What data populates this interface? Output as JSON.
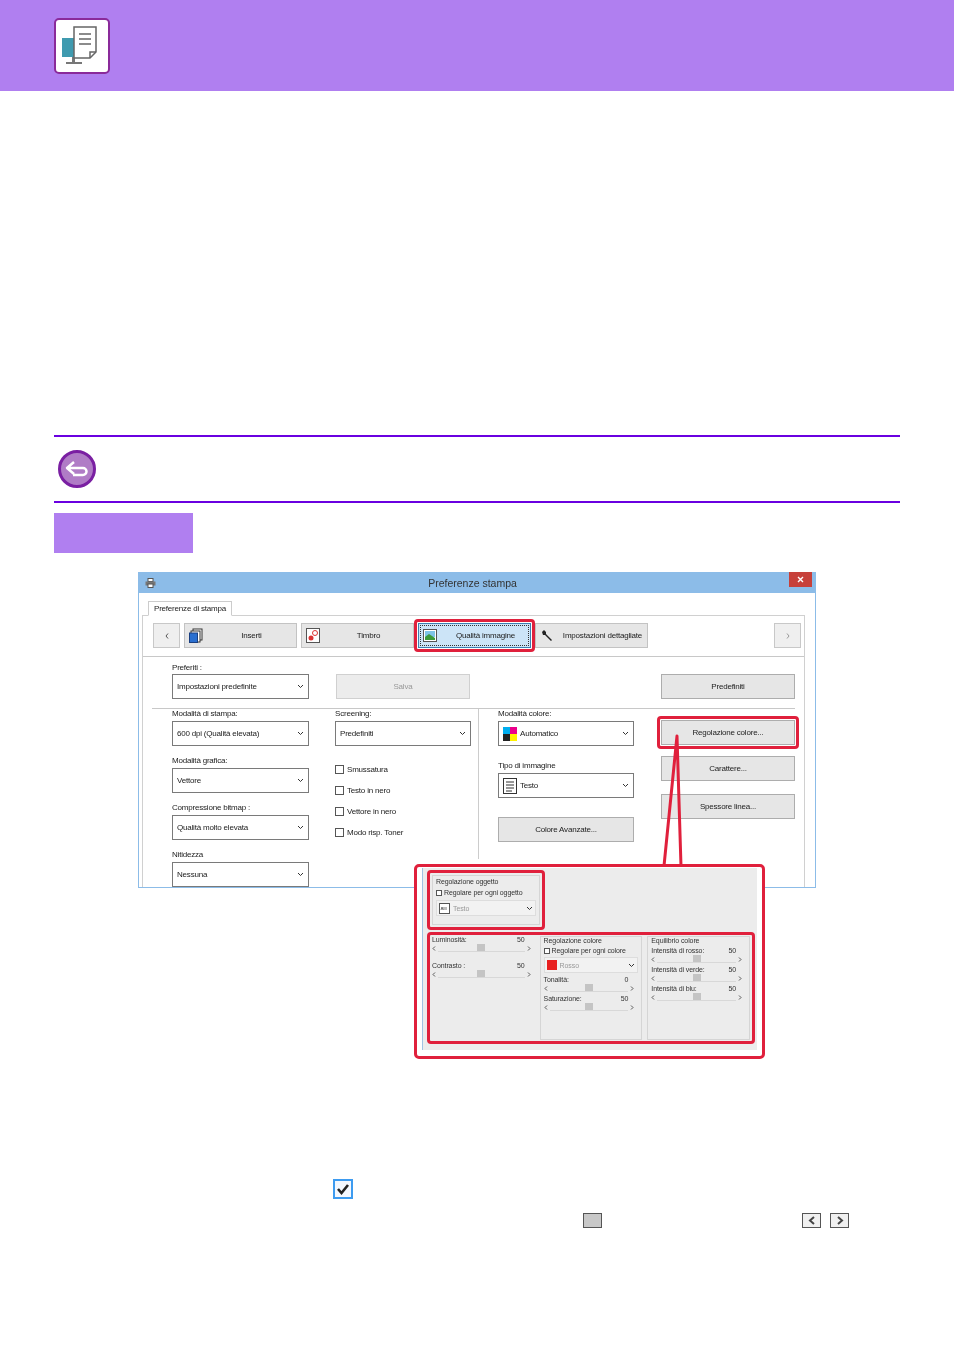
{
  "dialog": {
    "title": "Preferenze stampa",
    "page_tabs": [
      {
        "label": "Preferenze di stampa",
        "selected": true
      }
    ],
    "tabs": [
      {
        "label": "Inserti",
        "selected": false,
        "highlighted": false,
        "kind": "pages"
      },
      {
        "label": "Timbro",
        "selected": false,
        "highlighted": false,
        "kind": "stamp"
      },
      {
        "label": "Qualità immagine",
        "selected": true,
        "highlighted": true,
        "kind": "image"
      },
      {
        "label": "Impostazioni dettagliate",
        "selected": false,
        "highlighted": false,
        "kind": "wrench"
      }
    ],
    "favorites": {
      "label": "Preferiti :",
      "value": "Impostazioni predefinite"
    },
    "save_button": {
      "label": "Salva",
      "disabled": true
    },
    "defaults_button": {
      "label": "Predefiniti",
      "disabled": false
    },
    "left_fields": [
      {
        "label": "Modalità di stampa:",
        "value": "600 dpi (Qualità elevata)"
      },
      {
        "label": "Modalità grafica:",
        "value": "Vettore"
      },
      {
        "label": "Compressione bitmap :",
        "value": "Qualità molto elevata"
      },
      {
        "label": "Nitidezza",
        "value": "Nessuna"
      }
    ],
    "screening": {
      "label": "Screening:",
      "value": "Predefiniti"
    },
    "options": [
      {
        "label": "Smussatura",
        "checked": false
      },
      {
        "label": "Testo in nero",
        "checked": false
      },
      {
        "label": "Vettore in nero",
        "checked": false
      },
      {
        "label": "Modo risp. Toner",
        "checked": false
      }
    ],
    "color_mode": {
      "label": "Modalità colore:",
      "value": "Automatico"
    },
    "image_type": {
      "label": "Tipo di immagine",
      "value": "Testo"
    },
    "advanced_button": {
      "label": "Colore Avanzate..."
    },
    "side_buttons": [
      {
        "label": "Regolazione colore...",
        "highlighted": true
      },
      {
        "label": "Carattere...",
        "highlighted": false
      },
      {
        "label": "Spessore linea...",
        "highlighted": false
      }
    ]
  },
  "inset": {
    "object_adjustment": {
      "title": "Regolazione oggetto",
      "highlighted": true,
      "checkbox": {
        "label": "Regolare per ogni oggetto",
        "checked": false
      },
      "dropdown": {
        "value": "Testo",
        "disabled": true
      }
    },
    "adjustments_highlighted": true,
    "sliders": [
      {
        "label": "Luminosità:",
        "reading": "50",
        "level": 0.5
      },
      {
        "label": "Contrasto :",
        "reading": "50",
        "level": 0.5
      }
    ],
    "color_adjustment": {
      "title": "Regolazione colore",
      "checkbox": {
        "label": "Regolare per ogni colore",
        "checked": false
      },
      "dropdown": {
        "value": "Rosso",
        "disabled": true
      },
      "sliders": [
        {
          "label": "Tonalità:",
          "reading": "0",
          "level": 0.5
        },
        {
          "label": "Saturazione:",
          "reading": "50",
          "level": 0.5
        }
      ]
    },
    "color_balance": {
      "title": "Equilibrio colore",
      "sliders": [
        {
          "label": "Intensità di rosso:",
          "reading": "50",
          "level": 0.5
        },
        {
          "label": "Intensità di verde:",
          "reading": "50",
          "level": 0.5
        },
        {
          "label": "Intensità di blu:",
          "reading": "50",
          "level": 0.5
        }
      ]
    }
  },
  "legend": {
    "checkbox": {
      "checked": true
    }
  }
}
